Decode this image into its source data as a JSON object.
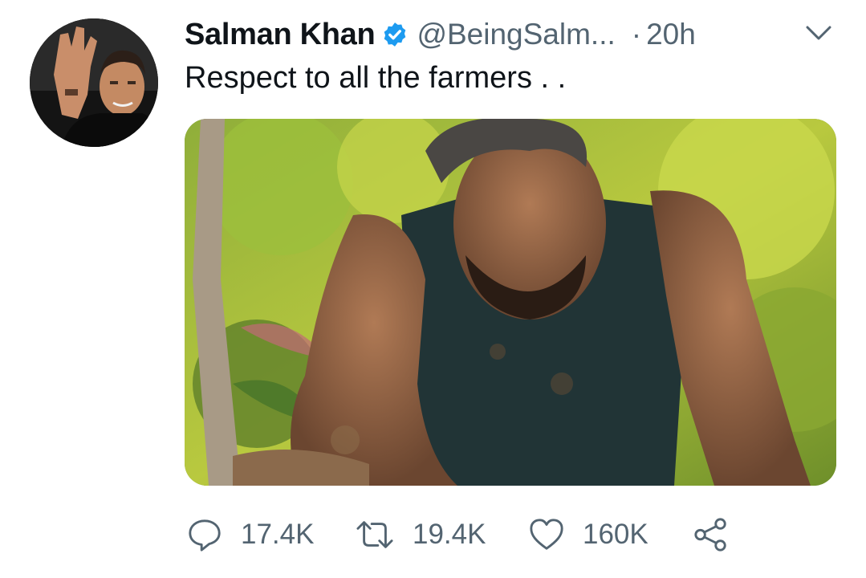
{
  "tweet": {
    "display_name": "Salman Khan",
    "handle": "@BeingSalm...",
    "separator": "·",
    "time": "20h",
    "text": "Respect to all the farmers . .",
    "icons": {
      "verified": "verified-badge-icon",
      "more": "chevron-down-icon",
      "reply": "reply-icon",
      "retweet": "retweet-icon",
      "like": "heart-icon",
      "share": "share-icon"
    },
    "counts": {
      "replies": "17.4K",
      "retweets": "19.4K",
      "likes": "160K"
    }
  },
  "colors": {
    "text_primary": "#0f1419",
    "text_secondary": "#536471",
    "verified_blue": "#1d9bf0"
  }
}
